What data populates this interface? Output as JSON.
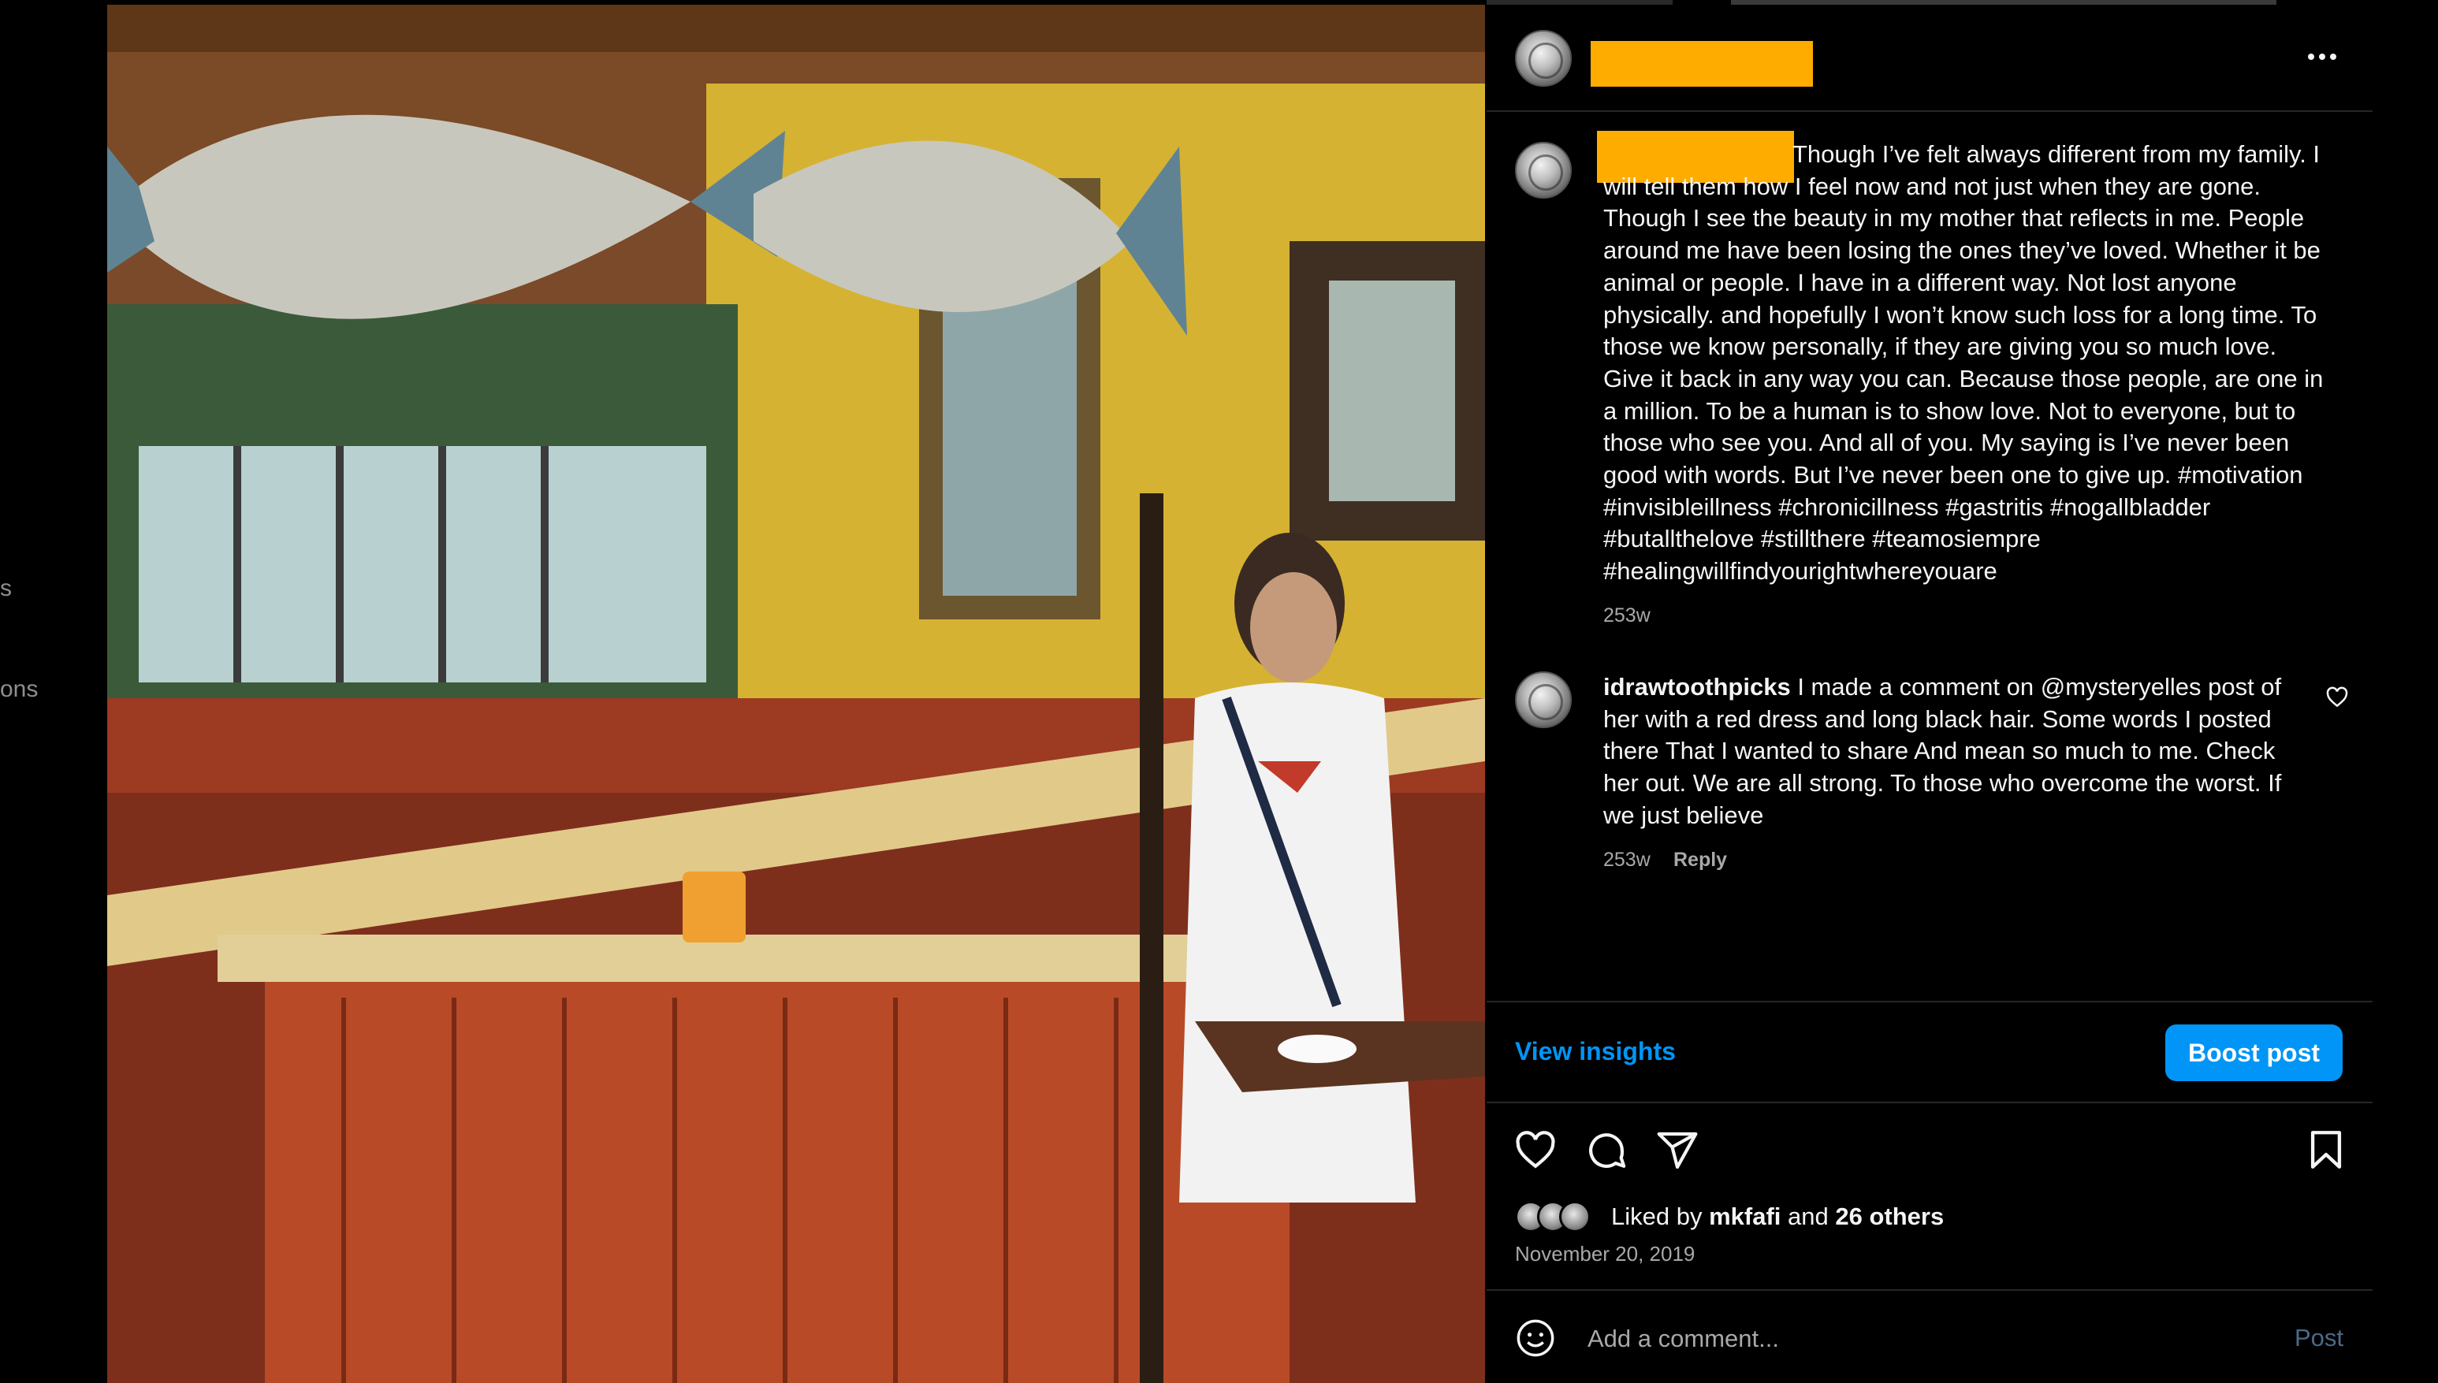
{
  "sidebar_fragments": [
    "s",
    "ons"
  ],
  "post": {
    "caption": "Though I’ve felt always different from my family. I will tell them how I feel now and not just when they are gone. Though I see the beauty in my mother that reflects in me. People around me have been losing the ones they’ve loved. Whether it be animal or people. I have in a different way. Not lost anyone physically. and hopefully I won’t know such loss for a long time. To those we know personally, if they are giving you so much love. Give it back in any way you can. Because those people, are one in a million. To be a human is to show love. Not to everyone, but to those who see you. And all of you. My saying is I’ve never been good with words. But I’ve never been one to give up. #motivation #invisibleillness #chronicillness #gastritis #nogallbladder #butallthelove #stillthere #teamosiempre #healingwillfindyourightwhereyouare",
    "caption_age": "253w"
  },
  "comment": {
    "username": "idrawtoothpicks",
    "text": "I made a comment on @mysteryelles post of her with a red dress and long black hair. Some words I posted there That I wanted to share And mean so much to me. Check her out. We are all strong. To those who overcome the worst. If we just believe",
    "age": "253w",
    "reply_label": "Reply"
  },
  "actions": {
    "insights_label": "View insights",
    "boost_label": "Boost post"
  },
  "likes": {
    "prefix": "Liked by",
    "user": "mkfafi",
    "connector": "and",
    "others": "26 others"
  },
  "date": "November 20, 2019",
  "comment_box": {
    "placeholder": "Add a comment...",
    "post_label": "Post"
  },
  "colors": {
    "accent": "#0095f6",
    "redaction": "#ffac00",
    "background": "#000000",
    "muted_text": "#a8a8a8"
  },
  "icons": [
    "more-icon",
    "heart-icon",
    "comment-icon",
    "share-icon",
    "bookmark-icon",
    "emoji-icon"
  ]
}
